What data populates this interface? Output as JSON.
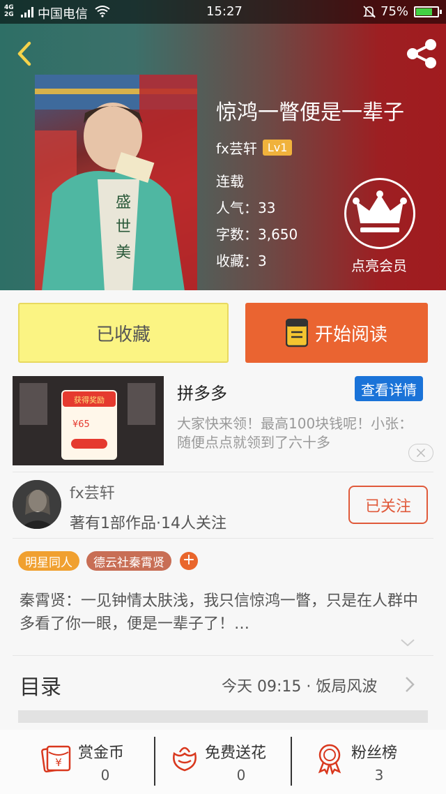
{
  "status_bar": {
    "network": "4G 2G",
    "carrier": "中国电信",
    "time": "15:27",
    "battery": "75%",
    "battery_level": 0.75
  },
  "header": {
    "back_icon": "chevron-left-icon",
    "share_icon": "share-icon"
  },
  "book": {
    "title": "惊鸿一瞥便是一辈子",
    "author": "fx芸轩",
    "level": "Lv1",
    "status": "连载",
    "popularity": "人气：33",
    "word_count": "字数：3,650",
    "favorites": "收藏：3"
  },
  "vip": {
    "label": "点亮会员",
    "icon": "crown-icon"
  },
  "actions": {
    "collected_label": "已收藏",
    "read_label": "开始阅读"
  },
  "ad": {
    "title": "拼多多",
    "detail_label": "查看详情",
    "description": "大家快来领！最高100块钱呢！小张：随便点点就领到了六十多",
    "banner_text": "获得奖励",
    "amount": "65"
  },
  "author_card": {
    "name": "fx芸轩",
    "stats": "著有1部作品·14人关注",
    "follow_label": "已关注"
  },
  "tags": [
    "明星同人",
    "德云社秦霄贤"
  ],
  "tag_add": "+",
  "intro": "秦霄贤：一见钟情太肤浅，我只信惊鸿一瞥，只是在人群中多看了你一眼，便是一辈子了！…",
  "toc": {
    "label": "目录",
    "latest": "今天 09:15 · 饭局风波"
  },
  "bottom_bar": [
    {
      "label": "赏金币",
      "count": "0",
      "icon": "reward-coin-icon"
    },
    {
      "label": "免费送花",
      "count": "0",
      "icon": "flower-icon"
    },
    {
      "label": "粉丝榜",
      "count": "3",
      "icon": "medal-icon"
    }
  ],
  "colors": {
    "accent_orange": "#ea6431",
    "collected_yellow": "#fbf483",
    "detail_blue": "#1a73d8",
    "tag_orange": "#f0a030",
    "tag_brown": "#c86e55",
    "icon_red": "#d9381e"
  }
}
